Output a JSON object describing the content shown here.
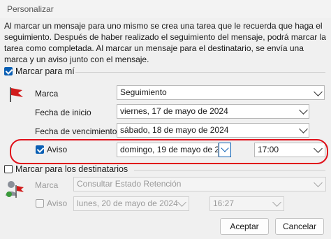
{
  "window": {
    "title": "Personalizar"
  },
  "description": "Al marcar un mensaje para uno mismo se crea una tarea que le recuerda que haga el seguimiento. Después de haber realizado el seguimiento del mensaje, podrá marcar la tarea como completada. Al marcar un mensaje para el destinatario, se envía una marca y un aviso junto con el mensaje.",
  "flag_for_me": {
    "checkbox_label": "Marcar para mí",
    "checked": true,
    "flag_color": "#d11b1b",
    "marca": {
      "label": "Marca",
      "value": "Seguimiento"
    },
    "start_date": {
      "label": "Fecha de inicio",
      "value": "viernes, 17 de mayo de 2024"
    },
    "due_date": {
      "label": "Fecha de vencimiento",
      "value": "sábado, 18 de mayo de 2024"
    },
    "reminder": {
      "label": "Aviso",
      "checked": true,
      "date_value": "domingo, 19 de mayo de 20",
      "time_value": "17:00"
    }
  },
  "flag_for_recipients": {
    "checkbox_label": "Marcar para los destinatarios",
    "checked": false,
    "marca": {
      "label": "Marca",
      "value": "Consultar Estado Retención"
    },
    "reminder": {
      "label": "Aviso",
      "checked": false,
      "date_value": "lunes, 20 de mayo de 2024",
      "time_value": "16:27"
    }
  },
  "buttons": {
    "accept": "Aceptar",
    "cancel": "Cancelar"
  },
  "annotation_color": "#e0101a",
  "accent_color": "#0a5fb4"
}
